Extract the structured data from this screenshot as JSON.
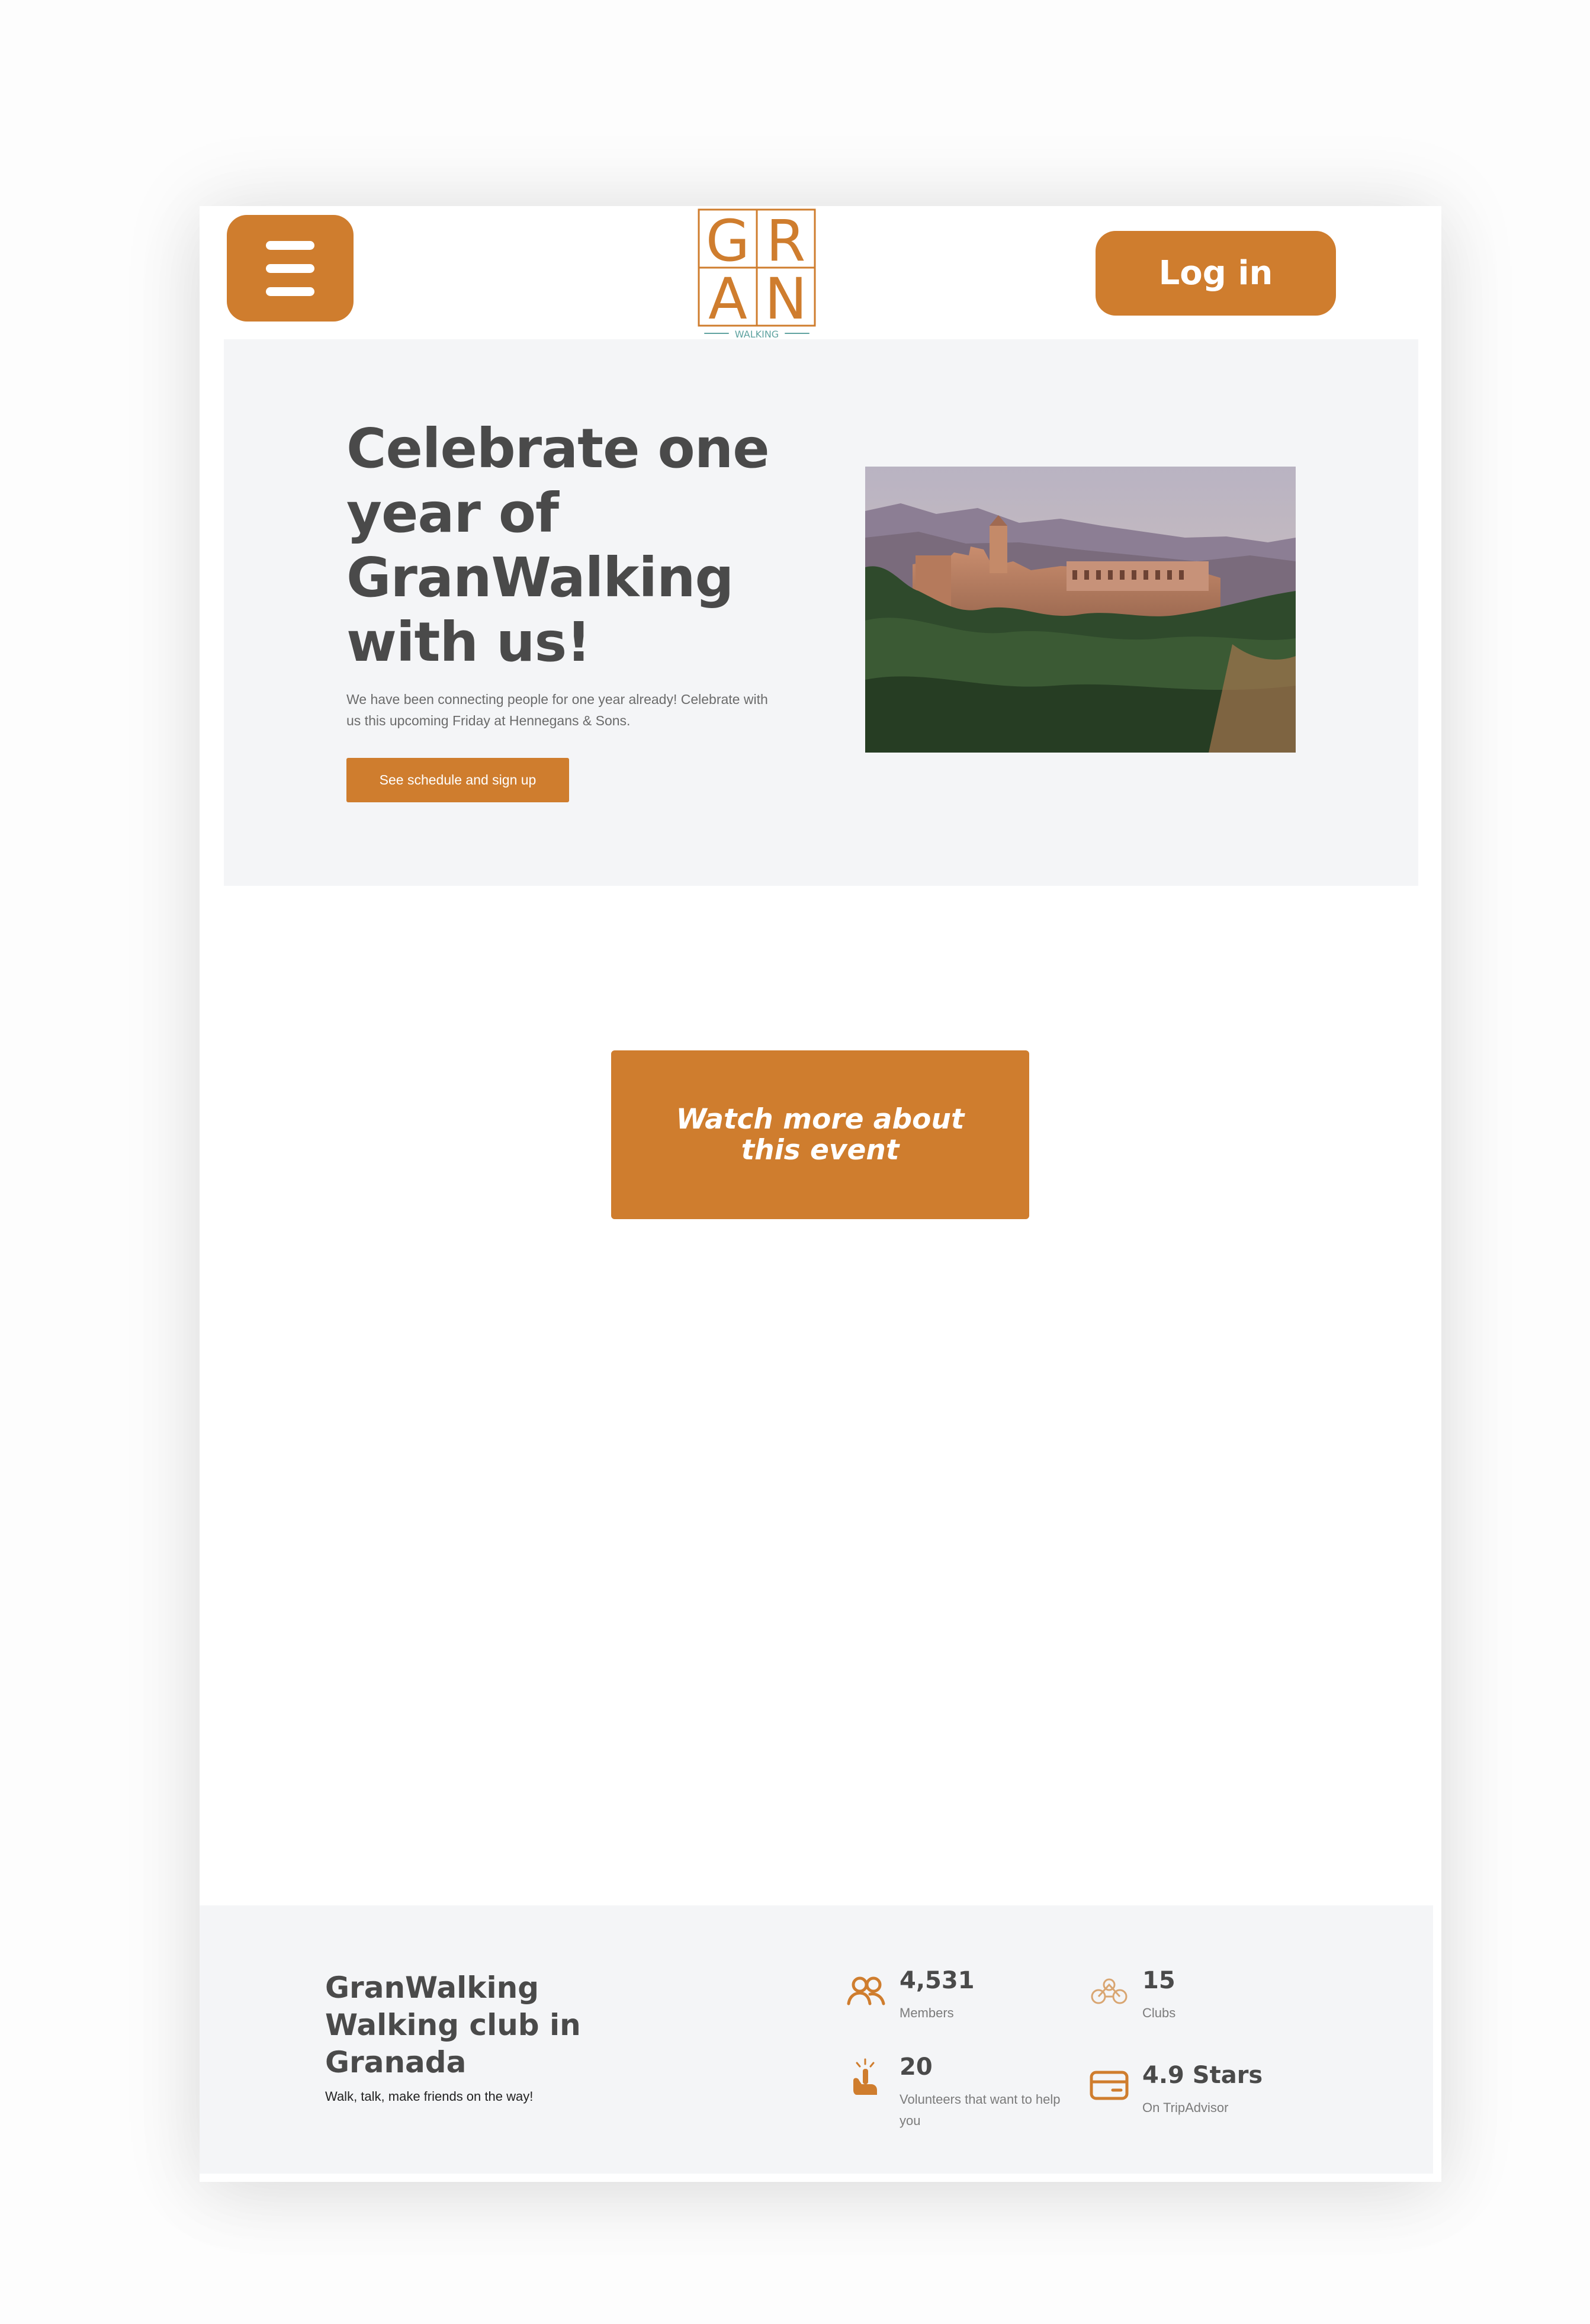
{
  "header": {
    "login_label": "Log in",
    "logo": {
      "letters_top": "GR",
      "letters_bottom": "AN",
      "tagline": "WALKING"
    }
  },
  "hero": {
    "title": "Celebrate one year of GranWalking with us!",
    "text": "We have been connecting people for one year already! Celebrate with us this upcoming Friday at Hennegans & Sons.",
    "cta_label": "See schedule and sign up"
  },
  "watch": {
    "label": "Watch more about this event"
  },
  "footer": {
    "title": "GranWalking Walking club in Granada",
    "subtitle": "Walk, talk, make friends on the way!",
    "stats": [
      {
        "value": "4,531",
        "label": "Members",
        "icon": "users-icon"
      },
      {
        "value": "15",
        "label": "Clubs",
        "icon": "bicycle-icon"
      },
      {
        "value": "20",
        "label": "Volunteers that want to help you",
        "icon": "raised-hand-icon"
      },
      {
        "value": "4.9 Stars",
        "label": "On TripAdvisor",
        "icon": "card-icon"
      }
    ]
  },
  "colors": {
    "accent": "#cf7d2e",
    "panel": "#f4f5f7",
    "text": "#4a4a4a"
  }
}
